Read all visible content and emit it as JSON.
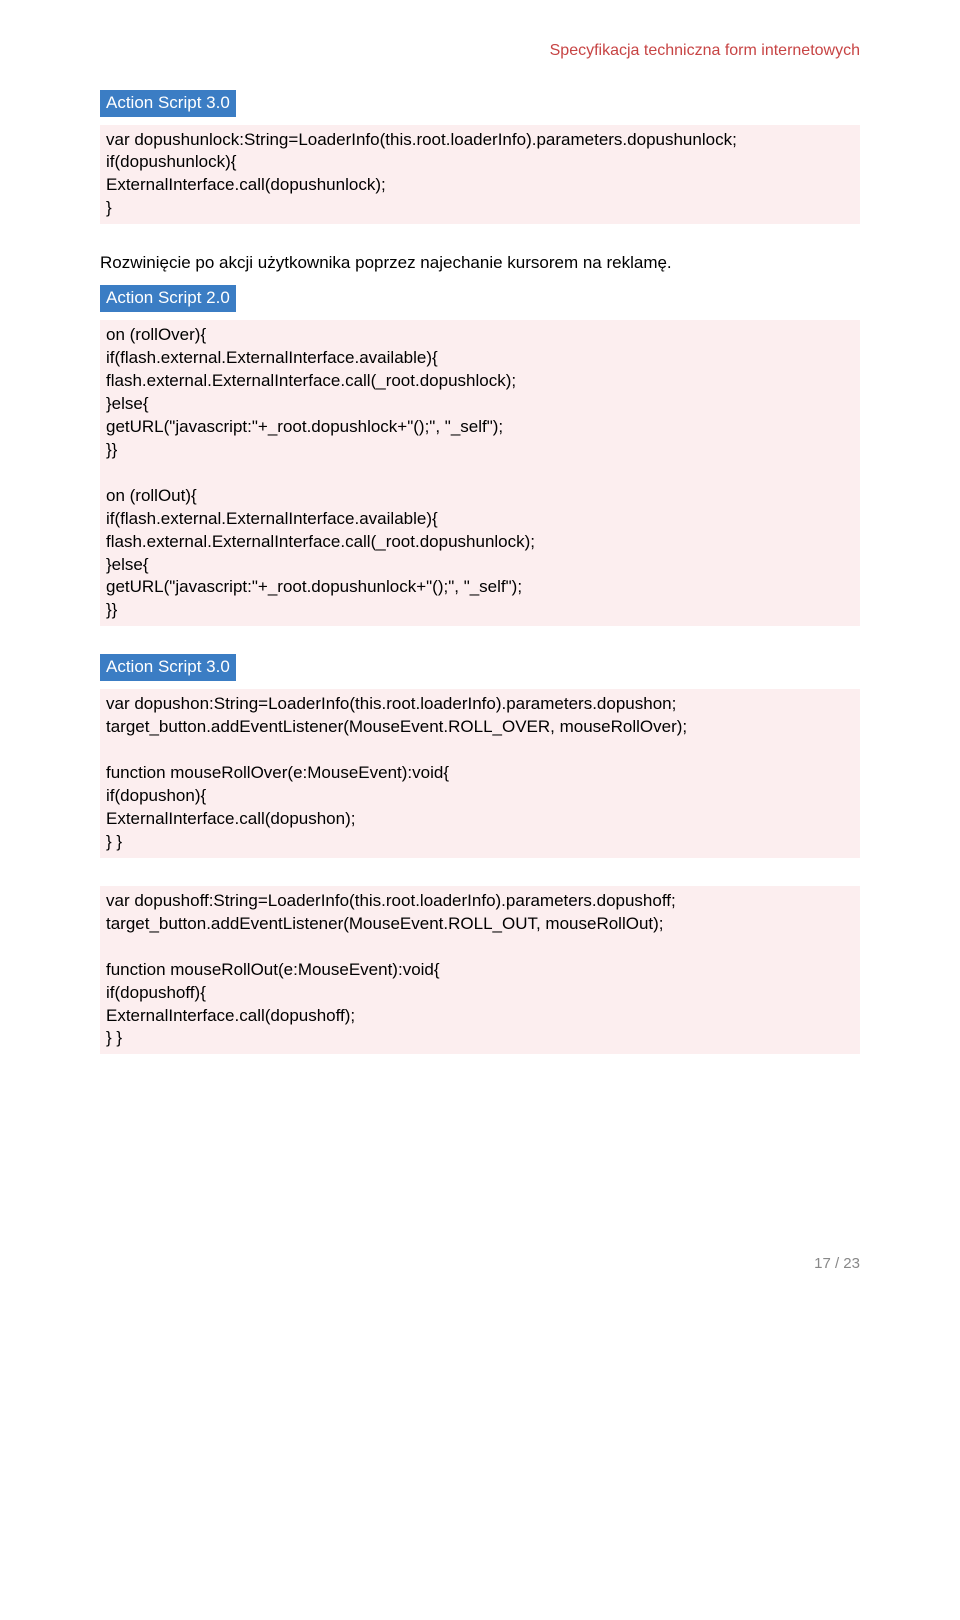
{
  "header": {
    "title": "Specyfikacja techniczna form internetowych"
  },
  "sections": [
    {
      "tag": "Action Script 3.0",
      "code": "var dopushunlock:String=LoaderInfo(this.root.loaderInfo).parameters.dopushunlock;\nif(dopushunlock){\nExternalInterface.call(dopushunlock);\n}"
    }
  ],
  "intro_text": "Rozwinięcie po akcji użytkownika poprzez najechanie kursorem na reklamę.",
  "section2": {
    "tag": "Action Script 2.0",
    "code": "on (rollOver){\nif(flash.external.ExternalInterface.available){\nflash.external.ExternalInterface.call(_root.dopushlock);\n}else{\ngetURL(\"javascript:\"+_root.dopushlock+\"();\", \"_self\");\n}}\n\non (rollOut){\nif(flash.external.ExternalInterface.available){\nflash.external.ExternalInterface.call(_root.dopushunlock);\n}else{\ngetURL(\"javascript:\"+_root.dopushunlock+\"();\", \"_self\");\n}}"
  },
  "section3": {
    "tag": "Action Script 3.0",
    "code1": "var dopushon:String=LoaderInfo(this.root.loaderInfo).parameters.dopushon;\ntarget_button.addEventListener(MouseEvent.ROLL_OVER, mouseRollOver);\n\nfunction mouseRollOver(e:MouseEvent):void{\nif(dopushon){\nExternalInterface.call(dopushon);\n} }",
    "code2": "var dopushoff:String=LoaderInfo(this.root.loaderInfo).parameters.dopushoff;\ntarget_button.addEventListener(MouseEvent.ROLL_OUT, mouseRollOut);\n\nfunction mouseRollOut(e:MouseEvent):void{\nif(dopushoff){\nExternalInterface.call(dopushoff);\n} }"
  },
  "footer": {
    "page": "17 / 23"
  }
}
